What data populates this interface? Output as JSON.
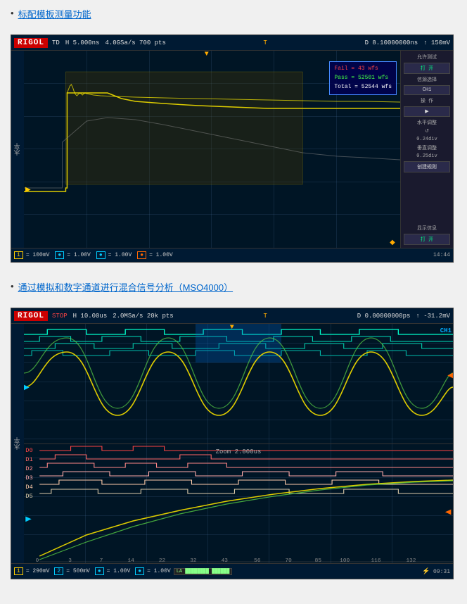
{
  "sections": [
    {
      "id": "section1",
      "link_text": "标配模板测量功能",
      "scope": {
        "logo": "RIGOL",
        "status": "TD",
        "timebase": "H  5.000ns",
        "sample_rate": "4.0GSa/s 700 pts",
        "trigger_time": "D  8.10000000ns",
        "trigger_level": "↑ 150mV",
        "measurement": {
          "fail": "Fail = 43 wfs",
          "pass": "Pass = 52501 wfs",
          "total": "Total = 52544 wfs"
        },
        "right_panel": {
          "test_label": "允许测试",
          "test_btn": "打  开",
          "source_label": "信源选择",
          "source_ch": "CH1",
          "op_label": "操  作",
          "op_btn": "▶",
          "h_adj_label": "水平调整",
          "h_adj_val": "0.24div",
          "v_adj_label": "垂直调整",
          "v_adj_val": "0.25div",
          "rule_btn": "创建规则",
          "info_label": "显示信息",
          "info_btn": "打  开"
        },
        "channels": [
          {
            "label": "1",
            "value": "= 100mV",
            "color": "yellow"
          },
          {
            "label": "",
            "value": "= 1.00V",
            "color": "cyan"
          },
          {
            "label": "",
            "value": "= 1.00V",
            "color": "cyan"
          },
          {
            "label": "",
            "value": "= 1.00V",
            "color": "orange"
          }
        ],
        "time": "14:44"
      }
    },
    {
      "id": "section2",
      "link_text": "通过模拟和数字通道进行混合信号分析（MSO4000）",
      "scope": {
        "logo": "RIGOL",
        "status": "STOP",
        "timebase": "H  10.00us",
        "sample_rate": "2.0MSa/s 20k pts",
        "trigger_time": "D  0.00000000ps",
        "trigger_level": "↑ -31.2mV",
        "zoom_label": "Zoom 2.000us",
        "ch1_label": "CH1",
        "channels": [
          {
            "label": "1",
            "value": "= 290mV",
            "color": "yellow"
          },
          {
            "label": "2",
            "value": "= 500mV",
            "color": "cyan"
          },
          {
            "label": "",
            "value": "= 1.00V",
            "color": "cyan"
          },
          {
            "label": "",
            "value": "= 1.00V",
            "color": "cyan"
          },
          {
            "label": "LA",
            "value": "",
            "color": "green"
          }
        ],
        "time": "09:31",
        "digital_channels": [
          "D0",
          "D1",
          "D2",
          "D3",
          "D4",
          "D5"
        ],
        "x_axis": [
          "0",
          "3",
          "7",
          "14",
          "22",
          "32",
          "43",
          "56",
          "70",
          "85",
          "100",
          "116",
          "132"
        ]
      }
    }
  ]
}
